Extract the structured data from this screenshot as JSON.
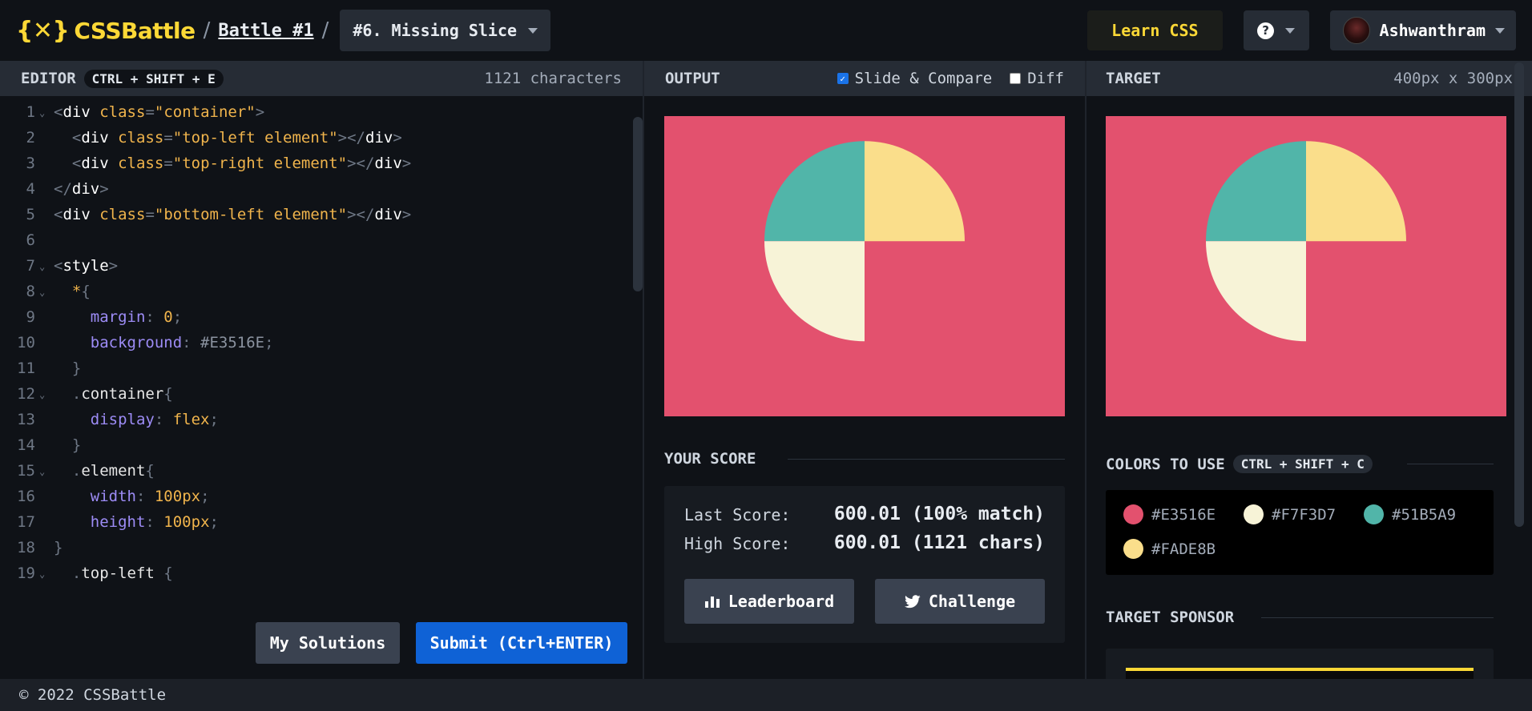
{
  "header": {
    "logo_text": "CSSBattle",
    "logo_mark": "{✕}",
    "separator": "/",
    "battle_link": "Battle #1",
    "target_select": "#6. Missing Slice",
    "learn_label": "Learn CSS",
    "help_icon": "question-icon",
    "user_name": "Ashwanthram"
  },
  "editor": {
    "title": "EDITOR",
    "shortcut": "CTRL + SHIFT + E",
    "char_count": "1121 characters",
    "my_solutions_label": "My Solutions",
    "submit_label": "Submit (Ctrl+ENTER)",
    "lines": [
      {
        "n": "1",
        "fold": true,
        "tokens": [
          [
            "p",
            "<"
          ],
          [
            "tag",
            "div"
          ],
          [
            "p",
            " "
          ],
          [
            "attr",
            "class"
          ],
          [
            "p",
            "="
          ],
          [
            "str",
            "\"container\""
          ],
          [
            "p",
            ">"
          ]
        ]
      },
      {
        "n": "2",
        "fold": false,
        "tokens": [
          [
            "p",
            "  <"
          ],
          [
            "tag",
            "div"
          ],
          [
            "p",
            " "
          ],
          [
            "attr",
            "class"
          ],
          [
            "p",
            "="
          ],
          [
            "str",
            "\"top-left element\""
          ],
          [
            "p",
            "></"
          ],
          [
            "tag",
            "div"
          ],
          [
            "p",
            ">"
          ]
        ]
      },
      {
        "n": "3",
        "fold": false,
        "tokens": [
          [
            "p",
            "  <"
          ],
          [
            "tag",
            "div"
          ],
          [
            "p",
            " "
          ],
          [
            "attr",
            "class"
          ],
          [
            "p",
            "="
          ],
          [
            "str",
            "\"top-right element\""
          ],
          [
            "p",
            "></"
          ],
          [
            "tag",
            "div"
          ],
          [
            "p",
            ">"
          ]
        ]
      },
      {
        "n": "4",
        "fold": false,
        "tokens": [
          [
            "p",
            "</"
          ],
          [
            "tag",
            "div"
          ],
          [
            "p",
            ">"
          ]
        ]
      },
      {
        "n": "5",
        "fold": false,
        "tokens": [
          [
            "p",
            "<"
          ],
          [
            "tag",
            "div"
          ],
          [
            "p",
            " "
          ],
          [
            "attr",
            "class"
          ],
          [
            "p",
            "="
          ],
          [
            "str",
            "\"bottom-left element\""
          ],
          [
            "p",
            "></"
          ],
          [
            "tag",
            "div"
          ],
          [
            "p",
            ">"
          ]
        ]
      },
      {
        "n": "6",
        "fold": false,
        "tokens": []
      },
      {
        "n": "7",
        "fold": true,
        "tokens": [
          [
            "p",
            "<"
          ],
          [
            "tag",
            "style"
          ],
          [
            "p",
            ">"
          ]
        ]
      },
      {
        "n": "8",
        "fold": true,
        "tokens": [
          [
            "p",
            "  "
          ],
          [
            "star",
            "*"
          ],
          [
            "p",
            "{"
          ]
        ]
      },
      {
        "n": "9",
        "fold": false,
        "tokens": [
          [
            "p",
            "    "
          ],
          [
            "prop",
            "margin"
          ],
          [
            "p",
            ": "
          ],
          [
            "num",
            "0"
          ],
          [
            "p",
            ";"
          ]
        ]
      },
      {
        "n": "10",
        "fold": false,
        "tokens": [
          [
            "p",
            "    "
          ],
          [
            "prop",
            "background"
          ],
          [
            "p",
            ": "
          ],
          [
            "hex",
            "#E3516E"
          ],
          [
            "p",
            ";"
          ]
        ]
      },
      {
        "n": "11",
        "fold": false,
        "tokens": [
          [
            "p",
            "  }"
          ]
        ]
      },
      {
        "n": "12",
        "fold": true,
        "tokens": [
          [
            "p",
            "  ."
          ],
          [
            "sel",
            "container"
          ],
          [
            "p",
            "{"
          ]
        ]
      },
      {
        "n": "13",
        "fold": false,
        "tokens": [
          [
            "p",
            "    "
          ],
          [
            "prop",
            "display"
          ],
          [
            "p",
            ": "
          ],
          [
            "num",
            "flex"
          ],
          [
            "p",
            ";"
          ]
        ]
      },
      {
        "n": "14",
        "fold": false,
        "tokens": [
          [
            "p",
            "  }"
          ]
        ]
      },
      {
        "n": "15",
        "fold": true,
        "tokens": [
          [
            "p",
            "  ."
          ],
          [
            "sel",
            "element"
          ],
          [
            "p",
            "{"
          ]
        ]
      },
      {
        "n": "16",
        "fold": false,
        "tokens": [
          [
            "p",
            "    "
          ],
          [
            "prop",
            "width"
          ],
          [
            "p",
            ": "
          ],
          [
            "num",
            "100"
          ],
          [
            "unit",
            "px"
          ],
          [
            "p",
            ";"
          ]
        ]
      },
      {
        "n": "17",
        "fold": false,
        "tokens": [
          [
            "p",
            "    "
          ],
          [
            "prop",
            "height"
          ],
          [
            "p",
            ": "
          ],
          [
            "num",
            "100"
          ],
          [
            "unit",
            "px"
          ],
          [
            "p",
            ";"
          ]
        ]
      },
      {
        "n": "18",
        "fold": false,
        "tokens": [
          [
            "p",
            "}"
          ]
        ]
      },
      {
        "n": "19",
        "fold": true,
        "tokens": [
          [
            "p",
            "  ."
          ],
          [
            "sel",
            "top-left"
          ],
          [
            "p",
            " {"
          ]
        ]
      }
    ]
  },
  "output": {
    "title": "OUTPUT",
    "slide_compare_label": "Slide & Compare",
    "slide_compare_checked": true,
    "diff_label": "Diff",
    "diff_checked": false
  },
  "target": {
    "title": "TARGET",
    "dimensions": "400px x 300px"
  },
  "score": {
    "title": "YOUR SCORE",
    "last_label": "Last Score:",
    "last_value": "600.01 (100% match)",
    "high_label": "High Score:",
    "high_value": "600.01 (1121 chars)",
    "leaderboard_label": "Leaderboard",
    "challenge_label": "Challenge"
  },
  "colors": {
    "title": "COLORS TO USE",
    "shortcut": "CTRL + SHIFT + C",
    "items": [
      {
        "hex": "#E3516E"
      },
      {
        "hex": "#F7F3D7"
      },
      {
        "hex": "#51B5A9"
      },
      {
        "hex": "#FADE8B"
      }
    ]
  },
  "sponsor": {
    "title": "TARGET SPONSOR"
  },
  "footer": {
    "copyright": "© 2022 CSSBattle"
  }
}
